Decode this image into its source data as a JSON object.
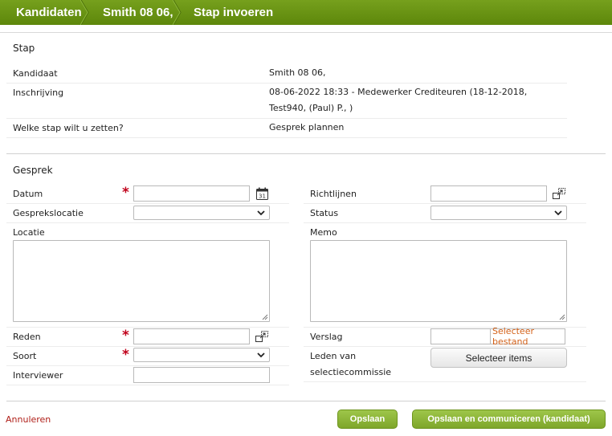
{
  "breadcrumb": [
    {
      "label": "Kandidaten"
    },
    {
      "label": "Smith 08 06,"
    },
    {
      "label": "Stap invoeren"
    }
  ],
  "stap": {
    "title": "Stap",
    "rows": [
      {
        "label": "Kandidaat",
        "value": "Smith 08 06,"
      },
      {
        "label": "Inschrijving",
        "value_line1": "08-06-2022 18:33 - Medewerker Crediteuren (18-12-2018,",
        "value_line2": "Test940, (Paul) P., )"
      },
      {
        "label": "Welke stap wilt u zetten?",
        "value": "Gesprek plannen"
      }
    ]
  },
  "gesprek": {
    "title": "Gesprek",
    "left": {
      "datum": {
        "label": "Datum",
        "value": "",
        "required": true
      },
      "gesprekslocatie": {
        "label": "Gesprekslocatie",
        "selected": ""
      },
      "locatie": {
        "label": "Locatie",
        "value": ""
      },
      "reden": {
        "label": "Reden",
        "value": "",
        "required": true
      },
      "soort": {
        "label": "Soort",
        "selected": "",
        "required": true
      },
      "interviewer": {
        "label": "Interviewer",
        "value": ""
      }
    },
    "right": {
      "richtlijnen": {
        "label": "Richtlijnen",
        "value": ""
      },
      "status": {
        "label": "Status",
        "selected": ""
      },
      "memo": {
        "label": "Memo",
        "value": ""
      },
      "verslag": {
        "label": "Verslag",
        "button": "Selecteer bestand"
      },
      "leden": {
        "label_line1": "Leden van",
        "label_line2": "selectiecommissie",
        "button": "Selecteer items"
      }
    }
  },
  "footer": {
    "cancel": "Annuleren",
    "save": "Opslaan",
    "save_communicate": "Opslaan en communiceren (kandidaat)"
  },
  "colors": {
    "header_green": "#6a9514",
    "button_green": "#8fb73b",
    "required_red": "#c0001a",
    "link_orange": "#d4621a",
    "cancel_red": "#b0201a"
  },
  "icons": {
    "calendar": "calendar-icon",
    "lookup": "lookup-icon",
    "chevron": "chevron-down-icon"
  }
}
